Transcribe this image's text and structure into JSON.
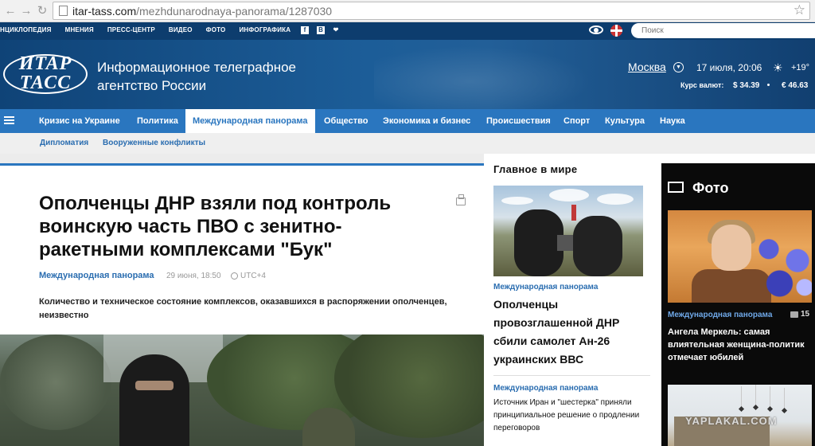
{
  "browser": {
    "url_host": "itar-tass.com",
    "url_path": "/mezhdunarodnaya-panorama/1287030"
  },
  "topbar": {
    "menu": [
      "НЦИКЛОПЕДИЯ",
      "МНЕНИЯ",
      "ПРЕСС-ЦЕНТР",
      "ВИДЕО",
      "ФОТО",
      "ИНФОГРАФИКА"
    ],
    "search_placeholder": "Поиск"
  },
  "header": {
    "logo_line1": "ИТАР",
    "logo_line2": "ТАСС",
    "tagline": "Информационное телеграфное агентство России",
    "city": "Москва",
    "date": "17 июля, 20:06",
    "temp": "+19°",
    "rates_label": "Курс валют:",
    "usd": "$ 34.39",
    "eur": "€ 46.63"
  },
  "nav": {
    "items": [
      "Кризис на Украине",
      "Политика",
      "Международная панорама",
      "Общество",
      "Экономика и бизнес",
      "Происшествия",
      "Спорт",
      "Культура",
      "Наука"
    ],
    "active_index": 2,
    "sub": [
      "Дипломатия",
      "Вооруженные конфликты"
    ]
  },
  "article": {
    "headline": "Ополченцы ДНР взяли под контроль воинскую часть ПВО с зенитно-ракетными комплексами \"Бук\"",
    "category": "Международная панорама",
    "date": "29 июня, 18:50",
    "tz": "UTC+4",
    "lead": "Количество и техническое состояние комплексов, оказавшихся в распоряжении ополченцев, неизвестно"
  },
  "middle": {
    "title": "Главное в мире",
    "item1": {
      "category": "Международная панорама",
      "headline": "Ополченцы провозглашенной ДНР сбили самолет Ан-26 украинских ВВС"
    },
    "item2": {
      "category": "Международная панорама",
      "headline": "Источник Иран и \"шестерка\" приняли принципиальное решение о продлении переговоров"
    }
  },
  "photo_col": {
    "title": "Фото",
    "category": "Международная панорама",
    "count": "15",
    "headline": "Ангела Меркель: самая влиятельная женщина-политик отмечает юбилей",
    "watermark": "YAPLAKAL.COM"
  }
}
